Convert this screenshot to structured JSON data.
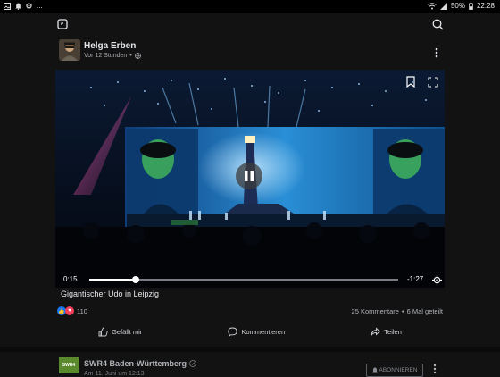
{
  "status_bar": {
    "battery": "50%",
    "time": "22:28",
    "overflow": "..."
  },
  "post": {
    "author": "Helga Erben",
    "timestamp": "Vor 12 Stunden",
    "privacy_icon": "globe-icon",
    "caption": "Gigantischer Udo in Leipzig",
    "reactions_count": "110",
    "comments": "25 Kommentare",
    "separator": "•",
    "shares": "6 Mal geteilt",
    "video": {
      "current_time": "0:15",
      "remaining_time": "-1:27",
      "progress": 0.15
    },
    "actions": {
      "like": "Gefällt mir",
      "comment": "Kommentieren",
      "share": "Teilen"
    }
  },
  "next_post": {
    "page_name": "SWR4 Baden-Württemberg",
    "logo_text": "SWR4",
    "date": "Am 11. Juni um 12:13",
    "subscribe_label": "ABONNIEREN"
  },
  "colors": {
    "background": "#121212",
    "like_blue": "#1877f2",
    "love_red": "#f33e58"
  }
}
